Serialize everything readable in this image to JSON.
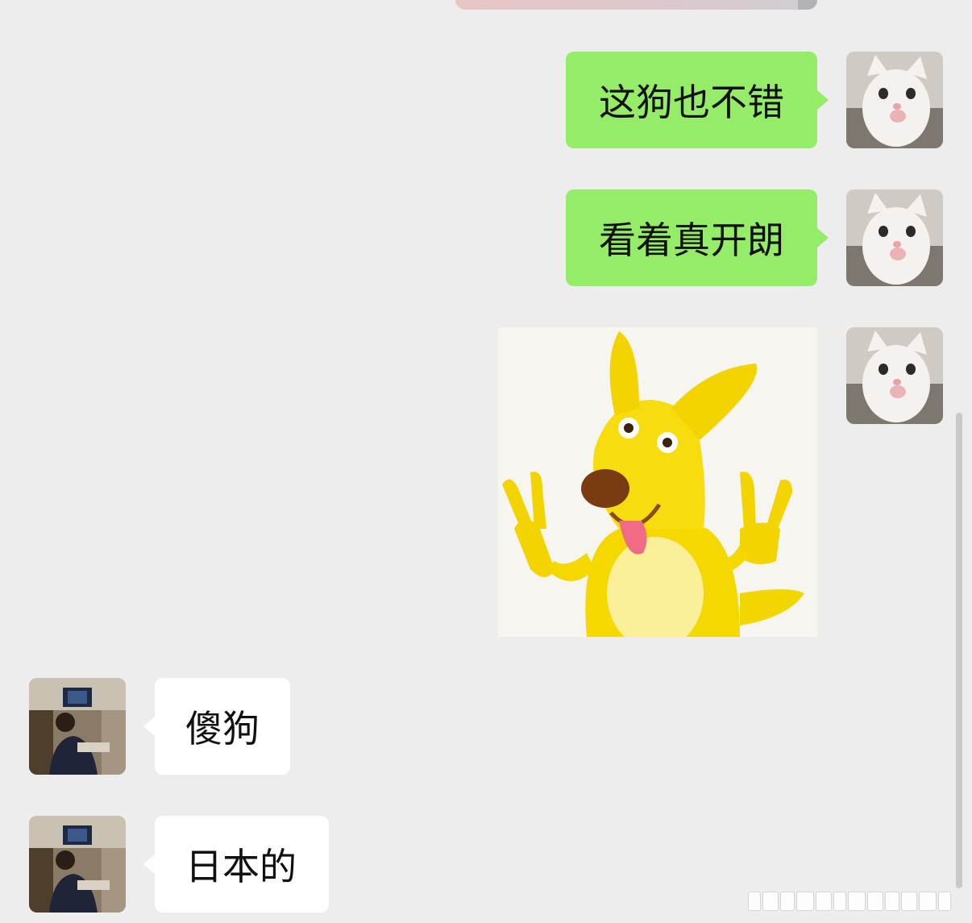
{
  "chat": {
    "messages": [
      {
        "sender": "me",
        "text": "这狗也不错"
      },
      {
        "sender": "me",
        "text": "看着真开朗"
      },
      {
        "sender": "me",
        "type": "sticker",
        "sticker_icon": "yellow-dog-peace-sign-sticker"
      },
      {
        "sender": "other",
        "text": "傻狗"
      },
      {
        "sender": "other",
        "text": "日本的"
      }
    ]
  },
  "colors": {
    "background": "#ededed",
    "my_bubble": "#95ec69",
    "other_bubble": "#ffffff",
    "text": "#111111"
  },
  "icons": {
    "my_avatar": "white-kitten-avatar-icon",
    "other_avatar": "man-in-car-avatar-icon"
  }
}
